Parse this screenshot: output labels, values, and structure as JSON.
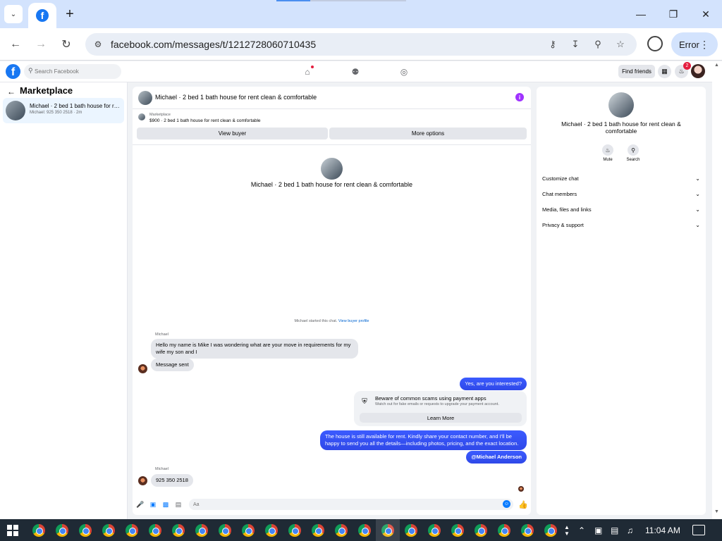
{
  "browser": {
    "url": "facebook.com/messages/t/1212728060710435",
    "profile_button_label": "Error",
    "new_tab": "+",
    "icons": [
      "tab-search-icon",
      "facebook-tab-icon",
      "minimize-icon",
      "restore-icon",
      "close-icon",
      "back-icon",
      "forward-icon",
      "reload-icon",
      "site-info-icon",
      "password-key-icon",
      "install-app-icon",
      "zoom-icon",
      "bookmark-star-icon",
      "profile-icon",
      "menu-dots-icon"
    ]
  },
  "fb_nav": {
    "logo": "f",
    "search_placeholder": "Search Facebook",
    "find_friends": "Find friends",
    "notification_count": "2"
  },
  "sidebar": {
    "title": "Marketplace",
    "conversation": {
      "name": "Michael · 2 bed 1 bath house for rent clean & comfortable",
      "preview": "Michael: 925 350 2518 · 2m"
    }
  },
  "chat": {
    "header_title": "Michael · 2 bed 1 bath house for rent clean & comfortable",
    "marketplace_label": "Marketplace",
    "listing_price_title": "$900 · 2 bed 1 bath house for rent clean & comfortable",
    "view_buyer": "View buyer",
    "more_options": "More options",
    "center_title": "Michael · 2 bed 1 bath house for rent clean & comfortable",
    "started_text": "Michael started this chat.",
    "view_buyer_profile": "View buyer profile",
    "messages": [
      {
        "sender": "Michael",
        "text": "Hello my name is Mike I was wondering what are your move in requirements for my wife my son and I"
      },
      {
        "text": "Message sent"
      },
      {
        "text": "Yes, are you interested?"
      },
      {
        "text": "The house is still available for rent. Kindly share your contact number, and I'll be happy to send you all the details—including photos, pricing, and the exact location."
      },
      {
        "text": "@Michael Anderson"
      },
      {
        "sender": "Michael",
        "text": "925 350 2518"
      }
    ],
    "scam_notice": {
      "title": "Beware of common scams using payment apps",
      "body": "Watch out for fake emails or requests to upgrade your payment account.",
      "button": "Learn More"
    },
    "composer_placeholder": "Aa"
  },
  "right_panel": {
    "title": "Michael · 2 bed 1 bath house for rent clean & comfortable",
    "actions": [
      {
        "label": "Mute"
      },
      {
        "label": "Search"
      }
    ],
    "sections": [
      "Customize chat",
      "Chat members",
      "Media, files and links",
      "Privacy & support"
    ]
  },
  "taskbar": {
    "time": "11:04 AM"
  },
  "colors": {
    "fb_blue": "#1877f2",
    "outgoing_bubble": "#3b5bff",
    "incoming_bubble": "#e4e6eb",
    "tabstrip": "#d3e3fd",
    "taskbar": "#1f2a35"
  }
}
